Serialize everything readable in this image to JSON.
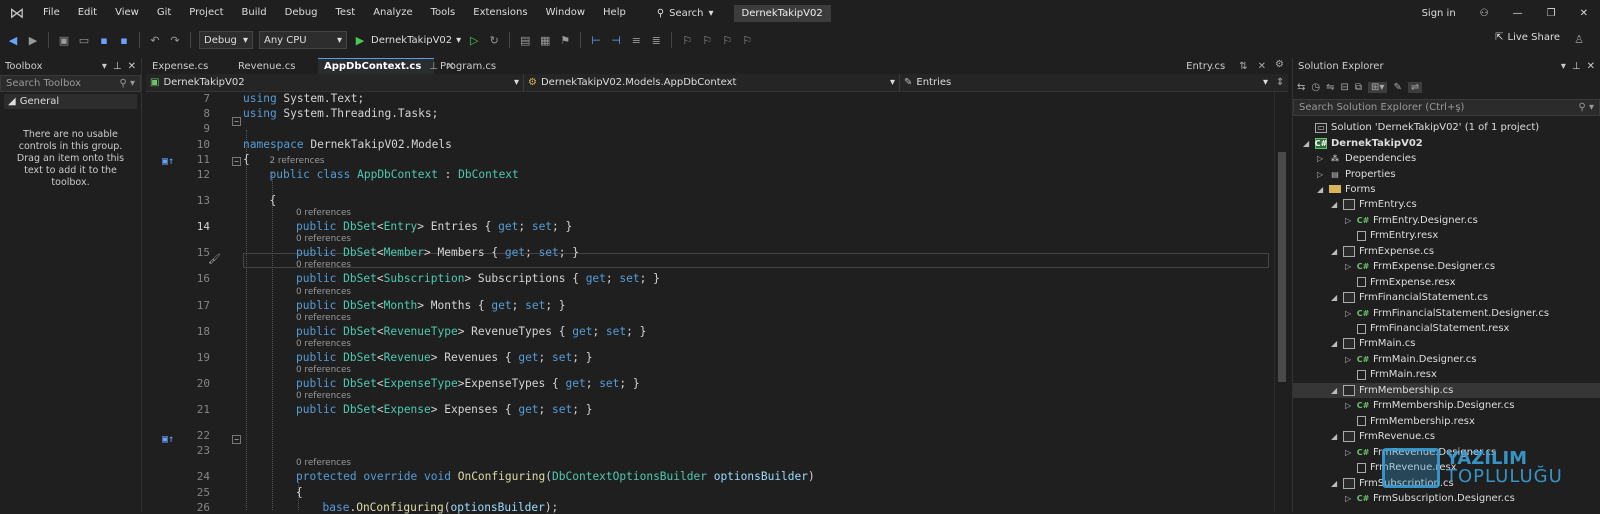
{
  "menubar": {
    "items": [
      "File",
      "Edit",
      "View",
      "Git",
      "Project",
      "Build",
      "Debug",
      "Test",
      "Analyze",
      "Tools",
      "Extensions",
      "Window",
      "Help"
    ],
    "search_label": "Search",
    "solution_name": "DernekTakipV02",
    "sign_in": "Sign in"
  },
  "toolbar": {
    "configuration": "Debug",
    "platform": "Any CPU",
    "startup_project": "DernekTakipV02",
    "live_share": "Live Share"
  },
  "toolbox": {
    "title": "Toolbox",
    "search_placeholder": "Search Toolbox",
    "group": "General",
    "empty_message": "There are no usable controls in this group. Drag an item onto this text to add it to the toolbox."
  },
  "editor": {
    "tabs": [
      {
        "label": "Expense.cs",
        "active": false
      },
      {
        "label": "Revenue.cs",
        "active": false
      },
      {
        "label": "AppDbContext.cs",
        "active": true
      },
      {
        "label": "Program.cs",
        "active": false
      }
    ],
    "preview_tab": "Entry.cs",
    "nav": {
      "project": "DernekTakipV02",
      "type": "DernekTakipV02.Models.AppDbContext",
      "member": "Entries"
    },
    "current_line": 14,
    "lines": [
      {
        "n": 7,
        "text": "using System.Text;"
      },
      {
        "n": 8,
        "text": "using System.Threading.Tasks;"
      },
      {
        "n": 9,
        "text": ""
      },
      {
        "n": 10,
        "text": "namespace DernekTakipV02.Models"
      },
      {
        "n": 11,
        "text": "{"
      },
      {
        "n": 12,
        "text": "public class AppDbContext : DbContext",
        "refs": "2 references"
      },
      {
        "n": 13,
        "text": "{"
      },
      {
        "n": 14,
        "text": "public DbSet<Entry> Entries { get; set; }",
        "refs": "0 references"
      },
      {
        "n": 15,
        "text": "public DbSet<Member> Members { get; set; }",
        "refs": "0 references"
      },
      {
        "n": 16,
        "text": "public DbSet<Subscription> Subscriptions { get; set; }",
        "refs": "0 references"
      },
      {
        "n": 17,
        "text": "public DbSet<Month> Months { get; set; }",
        "refs": "0 references"
      },
      {
        "n": 18,
        "text": "public DbSet<RevenueType> RevenueTypes { get; set; }",
        "refs": "0 references"
      },
      {
        "n": 19,
        "text": "public DbSet<Revenue> Revenues { get; set; }",
        "refs": "0 references"
      },
      {
        "n": 20,
        "text": "public DbSet<ExpenseType>ExpenseTypes { get; set; }",
        "refs": "0 references"
      },
      {
        "n": 21,
        "text": "public DbSet<Expense> Expenses { get; set; }",
        "refs": "0 references"
      },
      {
        "n": 22,
        "text": ""
      },
      {
        "n": 23,
        "text": ""
      },
      {
        "n": 24,
        "text": "protected override void OnConfiguring(DbContextOptionsBuilder optionsBuilder)",
        "refs": "0 references"
      },
      {
        "n": 25,
        "text": "{"
      },
      {
        "n": 26,
        "text": "base.OnConfiguring(optionsBuilder);"
      }
    ]
  },
  "solution_explorer": {
    "title": "Solution Explorer",
    "search_placeholder": "Search Solution Explorer (Ctrl+ş)",
    "items": [
      {
        "label": "Solution 'DernekTakipV02' (1 of 1 project)",
        "icon": "solution-icon",
        "depth": 0,
        "expander": ""
      },
      {
        "label": "DernekTakipV02",
        "icon": "project-icon",
        "depth": 0,
        "expander": "▲",
        "bold": true
      },
      {
        "label": "Dependencies",
        "icon": "dependencies-icon",
        "depth": 1,
        "expander": "▷"
      },
      {
        "label": "Properties",
        "icon": "properties-icon",
        "depth": 1,
        "expander": "▷"
      },
      {
        "label": "Forms",
        "icon": "folder-icon",
        "depth": 1,
        "expander": "▲"
      },
      {
        "label": "FrmEntry.cs",
        "icon": "form-icon",
        "depth": 2,
        "expander": "▲"
      },
      {
        "label": "FrmEntry.Designer.cs",
        "icon": "csharp-icon",
        "depth": 3,
        "expander": "▷"
      },
      {
        "label": "FrmEntry.resx",
        "icon": "resx-icon",
        "depth": 3,
        "expander": ""
      },
      {
        "label": "FrmExpense.cs",
        "icon": "form-icon",
        "depth": 2,
        "expander": "▲"
      },
      {
        "label": "FrmExpense.Designer.cs",
        "icon": "csharp-icon",
        "depth": 3,
        "expander": "▷"
      },
      {
        "label": "FrmExpense.resx",
        "icon": "resx-icon",
        "depth": 3,
        "expander": ""
      },
      {
        "label": "FrmFinancialStatement.cs",
        "icon": "form-icon",
        "depth": 2,
        "expander": "▲"
      },
      {
        "label": "FrmFinancialStatement.Designer.cs",
        "icon": "csharp-icon",
        "depth": 3,
        "expander": "▷"
      },
      {
        "label": "FrmFinancialStatement.resx",
        "icon": "resx-icon",
        "depth": 3,
        "expander": ""
      },
      {
        "label": "FrmMain.cs",
        "icon": "form-icon",
        "depth": 2,
        "expander": "▲"
      },
      {
        "label": "FrmMain.Designer.cs",
        "icon": "csharp-icon",
        "depth": 3,
        "expander": "▷"
      },
      {
        "label": "FrmMain.resx",
        "icon": "resx-icon",
        "depth": 3,
        "expander": ""
      },
      {
        "label": "FrmMembership.cs",
        "icon": "form-icon",
        "depth": 2,
        "expander": "▲",
        "selected": true
      },
      {
        "label": "FrmMembership.Designer.cs",
        "icon": "csharp-icon",
        "depth": 3,
        "expander": "▷"
      },
      {
        "label": "FrmMembership.resx",
        "icon": "resx-icon",
        "depth": 3,
        "expander": ""
      },
      {
        "label": "FrmRevenue.cs",
        "icon": "form-icon",
        "depth": 2,
        "expander": "▲"
      },
      {
        "label": "FrmRevenue.Designer.cs",
        "icon": "csharp-icon",
        "depth": 3,
        "expander": "▷"
      },
      {
        "label": "FrmRevenue.resx",
        "icon": "resx-icon",
        "depth": 3,
        "expander": ""
      },
      {
        "label": "FrmSubscription.cs",
        "icon": "form-icon",
        "depth": 2,
        "expander": "▲"
      },
      {
        "label": "FrmSubscription.Designer.cs",
        "icon": "csharp-icon",
        "depth": 3,
        "expander": "▷"
      }
    ]
  },
  "watermark": {
    "line1": "YAZILIM",
    "line2": "TOPLULUĞU"
  },
  "colors": {
    "background": "#1f1f1f",
    "keyword": "#569cd6",
    "type": "#4ec9b0",
    "method": "#dcdcaa",
    "parameter": "#9cdcfe",
    "accent": "#5f9be8"
  }
}
